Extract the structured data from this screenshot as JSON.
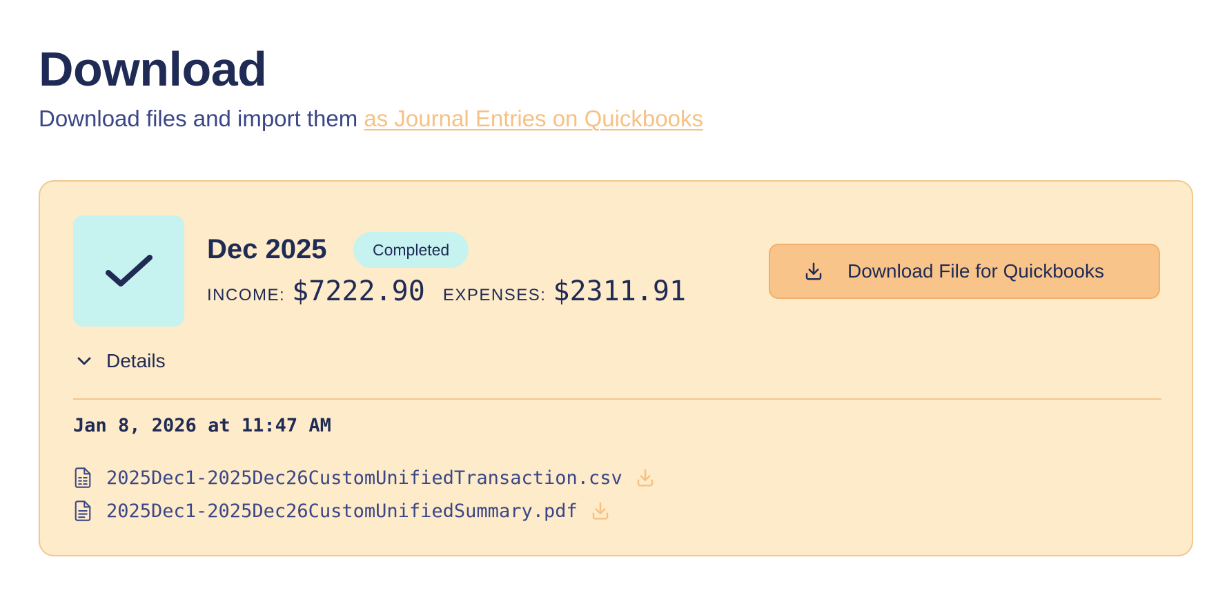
{
  "header": {
    "title": "Download",
    "subtitle_text": "Download files and import them ",
    "subtitle_link": "as Journal Entries on Quickbooks"
  },
  "card": {
    "status_icon": "check-icon",
    "period": "Dec 2025",
    "status_badge": "Completed",
    "income_label": "INCOME:",
    "income_value": "$7222.90",
    "expenses_label": "EXPENSES:",
    "expenses_value": "$2311.91",
    "download_button_label": "Download File for Quickbooks",
    "download_button_icon": "download-icon",
    "details_label": "Details",
    "details_icon": "chevron-down-icon",
    "timestamp": "Jan 8, 2026 at 11:47 AM",
    "files": [
      {
        "name": "2025Dec1-2025Dec26CustomUnifiedTransaction.csv",
        "icon": "spreadsheet-file-icon"
      },
      {
        "name": "2025Dec1-2025Dec26CustomUnifiedSummary.pdf",
        "icon": "document-file-icon"
      }
    ]
  },
  "colors": {
    "primary_text": "#1f2a55",
    "secondary_text": "#3a4687",
    "link": "#f6c184",
    "card_bg": "#fdebc9",
    "card_border": "#f0c890",
    "status_bg": "#c6f2f0",
    "button_bg": "#f9c489",
    "file_download_icon": "#f6c184"
  }
}
